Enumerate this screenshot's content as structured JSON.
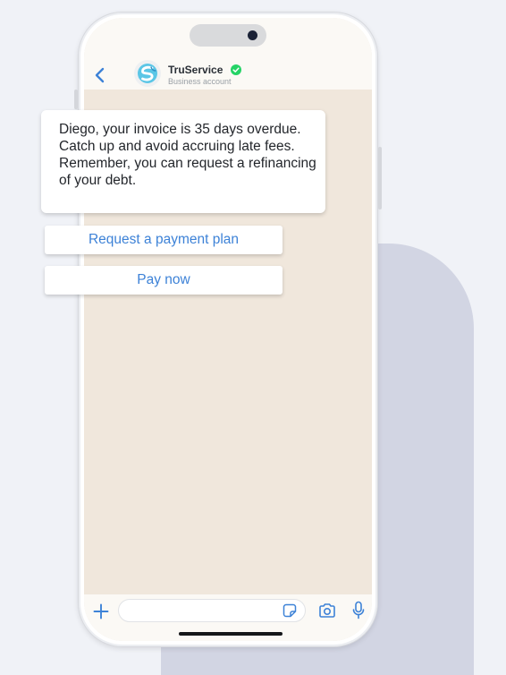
{
  "colors": {
    "page_background": "#f0f2f7",
    "decor_block": "#d2d5e3",
    "chat_background": "#f0e7dc",
    "header_background": "#fbf9f5",
    "accent_blue": "#3d82d7",
    "verified_green": "#25d366",
    "message_text": "#23262b"
  },
  "header": {
    "contact_name": "TruService",
    "contact_subtitle": "Business account",
    "icons": {
      "back": "chevron-left-icon",
      "avatar": "truservice-logo",
      "verified": "verified-badge-icon"
    }
  },
  "chat": {
    "message": "Diego, your invoice is 35 days overdue. Catch up and avoid accruing late fees. Remember, you can request a refinancing of your debt.",
    "quick_replies": [
      {
        "label": "Request a payment plan"
      },
      {
        "label": "Pay now"
      }
    ]
  },
  "composer": {
    "input_value": "",
    "input_placeholder": "",
    "icons": {
      "attach": "plus-icon",
      "sticker": "sticker-icon",
      "camera": "camera-icon",
      "microphone": "microphone-icon"
    }
  }
}
